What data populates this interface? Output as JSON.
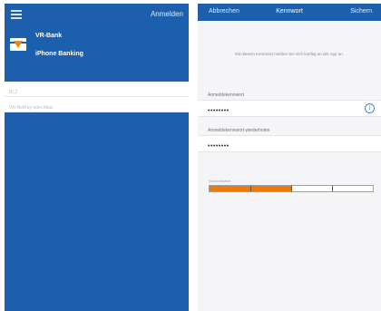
{
  "left_screen": {
    "header": {
      "login_label": "Anmelden",
      "bank_name": "VR-Bank",
      "app_name": "iPhone Banking"
    },
    "fields": [
      {
        "placeholder": "BLZ"
      },
      {
        "placeholder": "VR-NetKey oder Alias"
      }
    ],
    "colors": {
      "brand_blue": "#1b5fad",
      "logo_orange": "#f08a00"
    }
  },
  "right_screen": {
    "nav": {
      "cancel_label": "Abbrechen",
      "title": "Kennwort",
      "save_label": "Sichern"
    },
    "info_text": "Mit diesem Kennwort melden Sie sich künftig an der App an.",
    "password": {
      "label": "Anmeldekennwort",
      "value": "••••••••",
      "info_icon": "info-icon"
    },
    "password_repeat": {
      "label": "Anmeldekennwort wiederholen",
      "value": "••••••••"
    },
    "strength": {
      "label": "Kennwortstärke",
      "level": 0.5,
      "segments": 4
    },
    "colors": {
      "strength_orange": "#ec7a0b"
    }
  }
}
